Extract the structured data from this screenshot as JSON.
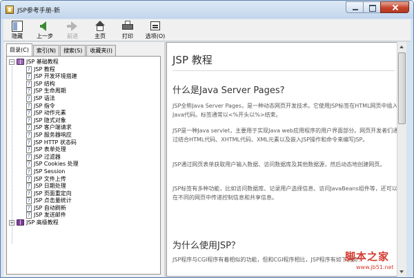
{
  "window": {
    "title": "JSP参考手册-新"
  },
  "toolbar": {
    "buttons": [
      {
        "label": "隐藏",
        "icon": "hide-pane-icon",
        "enabled": true
      },
      {
        "label": "上一步",
        "icon": "back-arrow-icon",
        "enabled": true
      },
      {
        "label": "前进",
        "icon": "forward-arrow-icon",
        "enabled": false
      },
      {
        "label": "主页",
        "icon": "home-icon",
        "enabled": true
      },
      {
        "label": "打印",
        "icon": "print-icon",
        "enabled": true
      },
      {
        "label": "选项(O)",
        "icon": "options-icon",
        "enabled": true
      }
    ]
  },
  "tabs": [
    {
      "label": "目录(C)",
      "active": true
    },
    {
      "label": "索引(N)",
      "active": false
    },
    {
      "label": "搜索(S)",
      "active": false
    },
    {
      "label": "收藏夹(I)",
      "active": false
    }
  ],
  "tree": {
    "root1": {
      "label": "JSP 基础教程",
      "expanded": true
    },
    "children": [
      "JSP 教程",
      "JSP 开发环境搭建",
      "JSP 结构",
      "JSP 生命周期",
      "JSP 语法",
      "JSP 指令",
      "JSP 动作元素",
      "JSP 隐式对象",
      "JSP 客户端请求",
      "JSP 服务器响应",
      "JSP HTTP 状态码",
      "JSP 表单处理",
      "JSP 过滤器",
      "JSP Cookies 处理",
      "JSP Session",
      "JSP 文件上传",
      "JSP 日期处理",
      "JSP 页面重定向",
      "JSP 点击量统计",
      "JSP 自动刷新",
      "JSP 发送邮件"
    ],
    "root2": {
      "label": "JSP 高级教程",
      "expanded": false
    }
  },
  "content": {
    "title": "JSP 教程",
    "section1_heading": "什么是Java Server Pages?",
    "p1": "JSP全称Java Server Pages，是一种动态网页开发技术。它使用JSP标签在HTML网页中插入Java代码。标签通常以<%开头以%>结束。",
    "p2": "JSP是一种Java servlet，主要用于实现Java web应用程序的用户界面部分。网页开发者们通过结合HTML代码、XHTML代码、XML元素以及嵌入JSP操作和命令来编写JSP。",
    "p3": "JSP通过网页表单获取用户输入数据、访问数据库及其他数据源，然后动态地创建网页。",
    "p4": "JSP标签有多种功能，比如访问数据库、记录用户选择信息、访问JavaBeans组件等，还可以在不同的网页中传递控制信息和共享信息。",
    "section2_heading": "为什么使用JSP？",
    "p5": "JSP程序与CGI程序有着相似的功能，但和CGI程序相比，JSP程序有如下优势："
  },
  "watermark": {
    "main": "脚本之家",
    "sub": "www.jb51.net"
  },
  "colors": {
    "accent_watermark": "#d43a2f",
    "titlebar": "#c3d6ec"
  }
}
